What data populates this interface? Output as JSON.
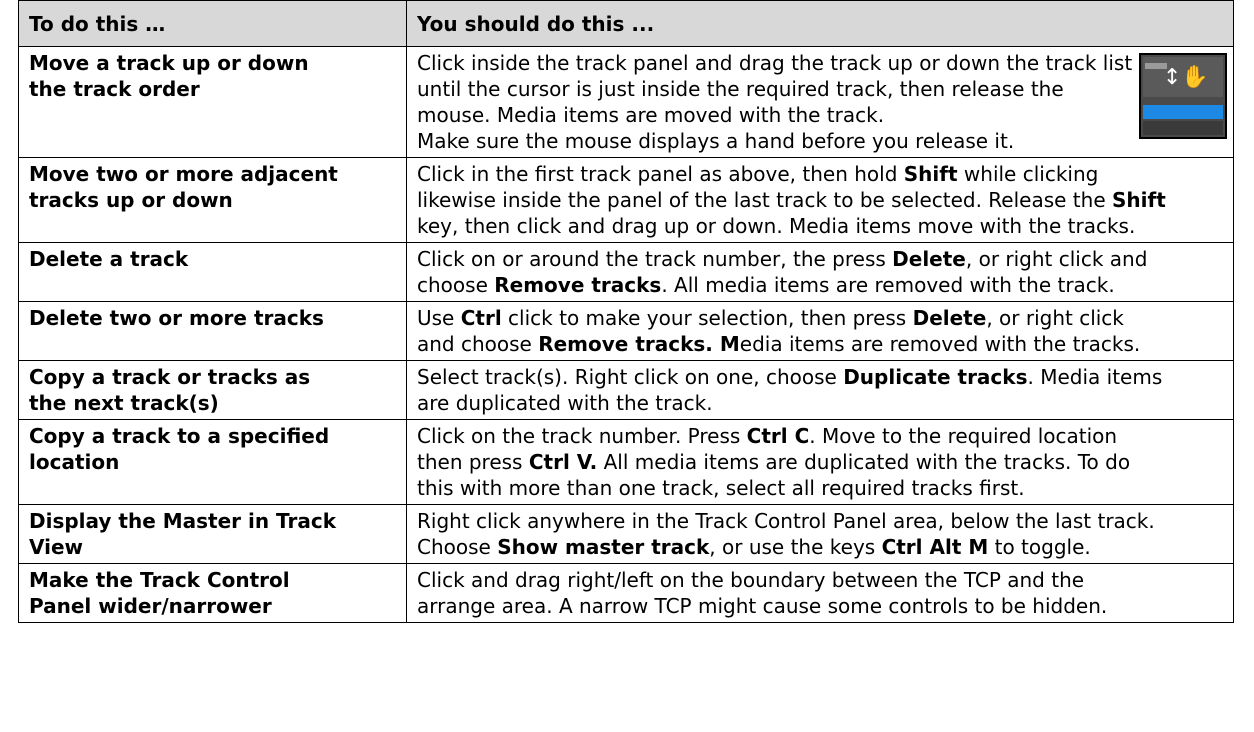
{
  "header": {
    "col1": "To do this …",
    "col2": "You should do this ..."
  },
  "rows": [
    {
      "task": [
        "Move a track up or down",
        "the track order"
      ],
      "how": [
        [
          {
            "t": "Click inside the track panel and drag the track up or down the track list"
          }
        ],
        [
          {
            "t": "until the cursor is just inside the required track, then release the"
          }
        ],
        [
          {
            "t": "mouse. Media items are moved with the track."
          }
        ],
        [
          {
            "t": "Make sure the mouse displays a hand before you release it."
          }
        ]
      ]
    },
    {
      "task": [
        "Move two or more adjacent",
        "tracks up or down"
      ],
      "how": [
        [
          {
            "t": "Click in the first track panel as above, then hold "
          },
          {
            "t": "Shift",
            "b": true
          },
          {
            "t": " while clicking"
          }
        ],
        [
          {
            "t": "likewise inside the panel of the last track to be selected. Release the "
          },
          {
            "t": "Shift",
            "b": true
          }
        ],
        [
          {
            "t": "key, then click and drag up or down. Media items move with the tracks."
          }
        ]
      ]
    },
    {
      "task": [
        "Delete a track"
      ],
      "how": [
        [
          {
            "t": "Click on or around the track number, the press "
          },
          {
            "t": "Delete",
            "b": true
          },
          {
            "t": ", or right click and"
          }
        ],
        [
          {
            "t": "choose "
          },
          {
            "t": "Remove tracks",
            "b": true
          },
          {
            "t": ". All media items are removed with the track."
          }
        ]
      ]
    },
    {
      "task": [
        "Delete two or more tracks"
      ],
      "how": [
        [
          {
            "t": "Use "
          },
          {
            "t": "Ctrl",
            "b": true
          },
          {
            "t": " click to make your selection, then press "
          },
          {
            "t": "Delete",
            "b": true
          },
          {
            "t": ", or right click"
          }
        ],
        [
          {
            "t": "and choose "
          },
          {
            "t": "Remove tracks. M",
            "b": true
          },
          {
            "t": "edia items are removed with the tracks."
          }
        ]
      ]
    },
    {
      "task": [
        "Copy a track or tracks as",
        "the next track(s)"
      ],
      "how": [
        [
          {
            "t": "Select track(s). Right click on one, choose "
          },
          {
            "t": "Duplicate tracks",
            "b": true
          },
          {
            "t": ". Media items"
          }
        ],
        [
          {
            "t": "are duplicated with the track."
          }
        ]
      ]
    },
    {
      "task": [
        "Copy a track to a specified",
        "location"
      ],
      "how": [
        [
          {
            "t": "Click on the track number. Press "
          },
          {
            "t": "Ctrl C",
            "b": true
          },
          {
            "t": ".  Move to the required location"
          }
        ],
        [
          {
            "t": "then press "
          },
          {
            "t": "Ctrl V.",
            "b": true
          },
          {
            "t": " All media items are duplicated with the tracks. To do"
          }
        ],
        [
          {
            "t": "this with more than one track, select all required tracks first."
          }
        ]
      ]
    },
    {
      "task": [
        "Display the Master in Track",
        "View"
      ],
      "how": [
        [
          {
            "t": "Right click anywhere in the Track Control Panel area, below the last track."
          }
        ],
        [
          {
            "t": "Choose "
          },
          {
            "t": "Show master track",
            "b": true
          },
          {
            "t": ", or use the keys "
          },
          {
            "t": "Ctrl Alt M",
            "b": true
          },
          {
            "t": " to toggle."
          }
        ]
      ]
    },
    {
      "task": [
        "Make the Track Control",
        "Panel wider/narrower"
      ],
      "how": [
        [
          {
            "t": "Click and drag right/left on the boundary between the TCP and the"
          }
        ],
        [
          {
            "t": "arrange area. A narrow TCP might cause some controls to be hidden."
          }
        ]
      ]
    }
  ],
  "images": {
    "cursor_screenshot_icon": "hand-move-cursor-icon"
  }
}
